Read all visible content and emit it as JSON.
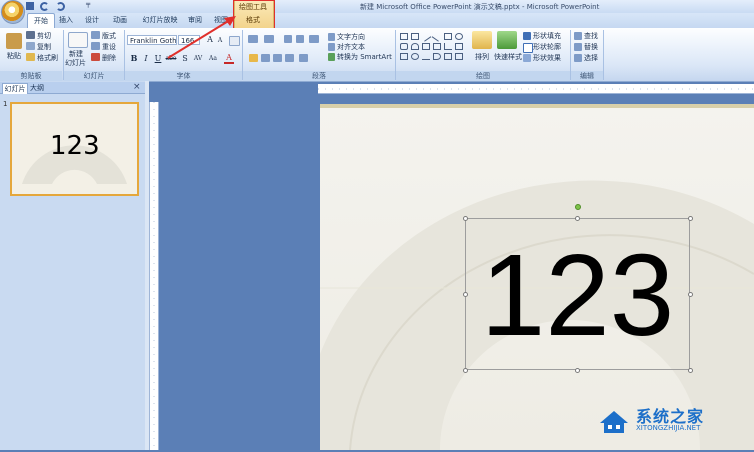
{
  "window": {
    "title": "新建 Microsoft Office PowerPoint 演示文稿.pptx - Microsoft PowerPoint"
  },
  "quick_access": {
    "more_glyph": "╤"
  },
  "tabs": {
    "home": "开始",
    "insert": "插入",
    "design": "设计",
    "animation": "动画",
    "transition": "幻灯片放映",
    "review": "审阅",
    "view": "视图",
    "contextual_group": "绘图工具",
    "format": "格式"
  },
  "ribbon": {
    "clipboard": {
      "paste": "粘贴",
      "cut": "剪切",
      "copy": "复制",
      "format_painter": "格式刷",
      "group_label": "剪贴板"
    },
    "slides": {
      "new_slide_line1": "新建",
      "new_slide_line2": "幻灯片",
      "layout": "版式",
      "reset": "重设",
      "delete": "删除",
      "group_label": "幻灯片"
    },
    "font": {
      "font_name": "Franklin Gothic",
      "font_size": "166",
      "bold": "B",
      "italic": "I",
      "underline": "U",
      "strike": "abe",
      "shadow": "S",
      "spacing": "AV",
      "case": "Aa",
      "color": "A",
      "grow": "A",
      "shrink": "A",
      "group_label": "字体"
    },
    "paragraph": {
      "text_direction": "文字方向",
      "align_text": "对齐文本",
      "convert_smartart": "转换为 SmartArt",
      "group_label": "段落"
    },
    "drawing": {
      "arrange": "排列",
      "quick_styles": "快速样式",
      "shape_fill": "形状填充",
      "shape_outline": "形状轮廓",
      "shape_effects": "形状效果",
      "group_label": "绘图"
    },
    "editing": {
      "find": "查找",
      "replace": "替换",
      "select": "选择",
      "group_label": "编辑"
    }
  },
  "left_pane": {
    "tab_slides": "幻灯片",
    "tab_outline": "大纲",
    "close": "×",
    "slide_number": "1",
    "thumbnail_text": "123"
  },
  "slide": {
    "text": "123"
  },
  "watermark": {
    "name": "系统之家",
    "url": "XITONGZHIJIA.NET"
  },
  "colors": {
    "accent": "#e0302c",
    "contextual_tab": "#f2d38a",
    "ribbon": "#dbe7f7",
    "workspace": "#5b7fb6"
  }
}
